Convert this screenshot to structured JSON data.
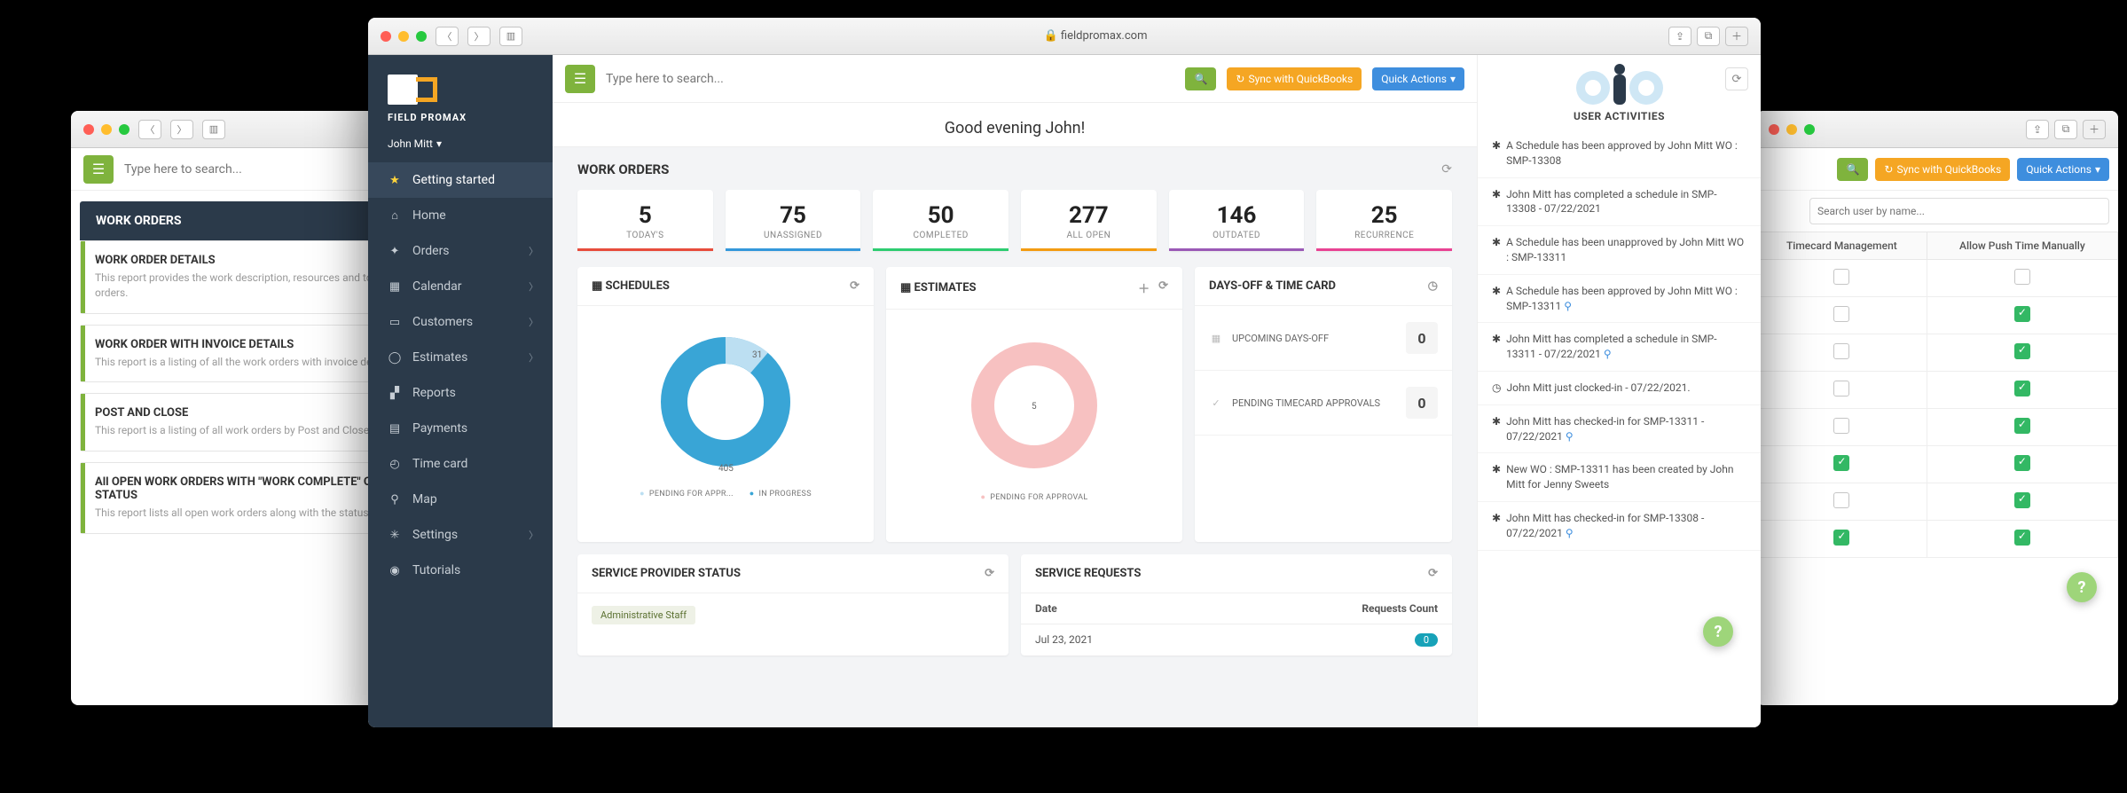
{
  "chrome": {
    "url": "fieldpromax.com"
  },
  "brand": {
    "name": "FIELD PROMAX",
    "user": "John Mitt"
  },
  "search_placeholder": "Type here to search...",
  "buttons": {
    "sync": "Sync with QuickBooks",
    "quick": "Quick Actions",
    "sync_short": "Sync with QuickBooks",
    "quick_short": "Quick Actions"
  },
  "nav": [
    {
      "icon": "★",
      "label": "Getting started",
      "active": true
    },
    {
      "icon": "⌂",
      "label": "Home",
      "chev": false
    },
    {
      "icon": "✦",
      "label": "Orders",
      "chev": true
    },
    {
      "icon": "▦",
      "label": "Calendar",
      "chev": true
    },
    {
      "icon": "▭",
      "label": "Customers",
      "chev": true
    },
    {
      "icon": "◯",
      "label": "Estimates",
      "chev": true
    },
    {
      "icon": "▞",
      "label": "Reports",
      "chev": false
    },
    {
      "icon": "▤",
      "label": "Payments",
      "chev": false
    },
    {
      "icon": "◴",
      "label": "Time card",
      "chev": false
    },
    {
      "icon": "⚲",
      "label": "Map",
      "chev": false
    },
    {
      "icon": "✳",
      "label": "Settings",
      "chev": true
    },
    {
      "icon": "◉",
      "label": "Tutorials",
      "chev": false
    }
  ],
  "greeting": "Good evening John!",
  "work_orders_title": "WORK ORDERS",
  "kpis": [
    {
      "v": "5",
      "l": "TODAY'S"
    },
    {
      "v": "75",
      "l": "UNASSIGNED"
    },
    {
      "v": "50",
      "l": "COMPLETED"
    },
    {
      "v": "277",
      "l": "ALL OPEN"
    },
    {
      "v": "146",
      "l": "OUTDATED"
    },
    {
      "v": "25",
      "l": "RECURRENCE"
    }
  ],
  "schedules": {
    "title": "SCHEDULES",
    "pending": 31,
    "inprogress": 405,
    "legend_a": "PENDING FOR APPR...",
    "legend_b": "IN PROGRESS"
  },
  "estimates": {
    "title": "ESTIMATES",
    "center": "5",
    "legend": "PENDING FOR APPROVAL"
  },
  "days": {
    "title": "DAYS-OFF & TIME CARD",
    "rows": [
      {
        "icon": "▦",
        "label": "UPCOMING DAYS-OFF",
        "count": "0"
      },
      {
        "icon": "✓",
        "label": "PENDING TIMECARD APPROVALS",
        "count": "0"
      }
    ]
  },
  "sp": {
    "title": "SERVICE PROVIDER STATUS",
    "tag": "Administrative Staff"
  },
  "sr": {
    "title": "SERVICE REQUESTS",
    "col1": "Date",
    "col2": "Requests Count",
    "row_date": "Jul 23, 2021",
    "row_count": "0"
  },
  "activities": {
    "title": "USER ACTIVITIES",
    "items": [
      {
        "icon": "✱",
        "text": "A Schedule has been approved by John Mitt WO : SMP-13308"
      },
      {
        "icon": "✱",
        "text": "John Mitt has completed a schedule in SMP-13308 - 07/22/2021"
      },
      {
        "icon": "✱",
        "text": "A Schedule has been unapproved by John Mitt WO : SMP-13311"
      },
      {
        "icon": "✱",
        "text": "A Schedule has been approved by John Mitt WO : SMP-13311",
        "loc": true
      },
      {
        "icon": "✱",
        "text": "John Mitt has completed a schedule in SMP-13311 - 07/22/2021",
        "loc": true
      },
      {
        "icon": "◷",
        "text": "John Mitt just clocked-in - 07/22/2021."
      },
      {
        "icon": "✱",
        "text": "John Mitt has checked-in for SMP-13311 - 07/22/2021",
        "loc": true
      },
      {
        "icon": "✱",
        "text": "New WO : SMP-13311 has been created by John Mitt for Jenny Sweets"
      },
      {
        "icon": "✱",
        "text": "John Mitt has checked-in for SMP-13308 - 07/22/2021",
        "loc": true
      }
    ]
  },
  "win1": {
    "head": "WORK ORDERS",
    "reports": [
      {
        "t": "WORK ORDER DETAILS",
        "s": "This report provides the work description, resources and total amount of the work orders."
      },
      {
        "t": "WORK ORDER WITH INVOICE DETAILS",
        "s": "This report is a listing of all the work orders with invoice details."
      },
      {
        "t": "POST AND CLOSE",
        "s": "This report is a listing of all work orders by Post and Close date"
      },
      {
        "t": "All OPEN WORK ORDERS WITH \"WORK COMPLETE\" OR \"APPROVED\" STATUS",
        "s": "This report lists all open work orders along with the status of each schedule."
      }
    ]
  },
  "win3": {
    "search_ph": "Search user by name...",
    "col1": "Timecard Management",
    "col2": "Allow Push Time Manually",
    "rows": [
      {
        "a": false,
        "b": false
      },
      {
        "a": false,
        "b": true
      },
      {
        "a": false,
        "b": true
      },
      {
        "a": false,
        "b": true
      },
      {
        "a": false,
        "b": true
      },
      {
        "a": true,
        "b": true
      },
      {
        "a": false,
        "b": true
      },
      {
        "a": true,
        "b": true
      }
    ]
  }
}
